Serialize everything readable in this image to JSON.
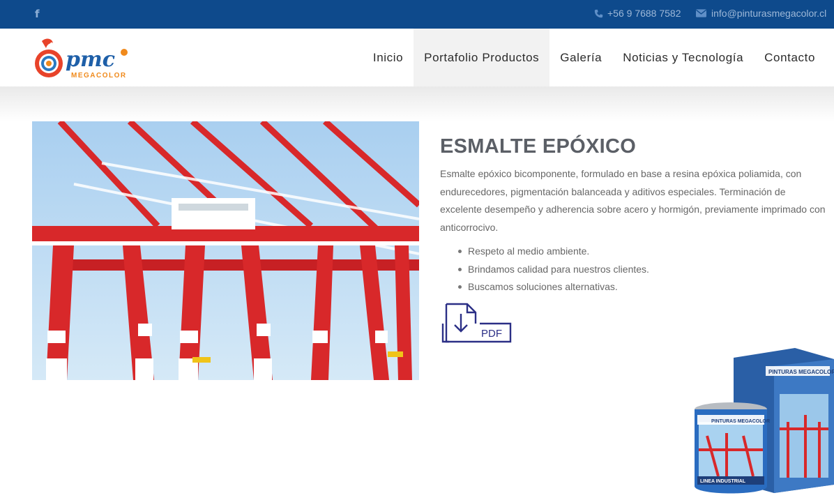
{
  "topbar": {
    "facebook_icon": "f",
    "phone": "+56 9 7688 7582",
    "email": "info@pinturasmegacolor.cl"
  },
  "logo": {
    "text": "pmc",
    "subtext": "MEGACOLOR"
  },
  "nav": {
    "items": [
      {
        "label": "Inicio"
      },
      {
        "label": "Portafolio Productos"
      },
      {
        "label": "Galería"
      },
      {
        "label": "Noticias y Tecnología"
      },
      {
        "label": "Contacto"
      }
    ],
    "active_index": 1
  },
  "product": {
    "title": "ESMALTE EPÓXICO",
    "description": "Esmalte epóxico bicomponente, formulado en base a resina epóxica poliamida, con endurecedores, pigmentación balanceada y aditivos especiales. Terminación de excelente desempeño y adherencia sobre acero y hormigón, previamente imprimado con anticorrocivo.",
    "bullets": [
      "Respeto al medio ambiente.",
      "Brindamos calidad para nuestros clientes.",
      "Buscamos soluciones alternativas."
    ],
    "pdf_label": "PDF"
  },
  "cans": {
    "brand": "PINTURAS MEGACOLOR",
    "line": "LINEA INDUSTRIAL"
  },
  "colors": {
    "topbar": "#0e4a8c",
    "pdf_icon": "#2b2f86",
    "crane_red": "#d8282a",
    "sky": "#b9d9f2"
  }
}
